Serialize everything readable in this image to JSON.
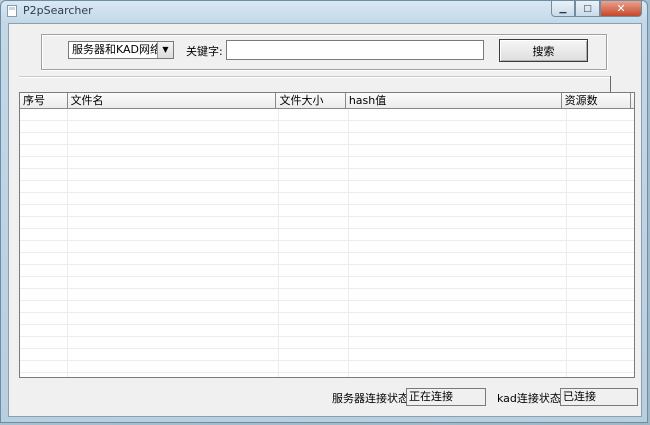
{
  "window": {
    "title": "P2pSearcher",
    "minimize_glyph": "▁",
    "maximize_glyph": "□",
    "close_glyph": "✕"
  },
  "search": {
    "network_selected": "服务器和KAD网络",
    "keyword_label": "关键字:",
    "keyword_value": "",
    "search_button": "搜索"
  },
  "list": {
    "columns": [
      "序号",
      "文件名",
      "文件大小",
      "hash值",
      "资源数"
    ]
  },
  "status": {
    "server_label": "服务器连接状态:",
    "server_value": "正在连接",
    "kad_label": "kad连接状态:",
    "kad_value": "已连接"
  }
}
